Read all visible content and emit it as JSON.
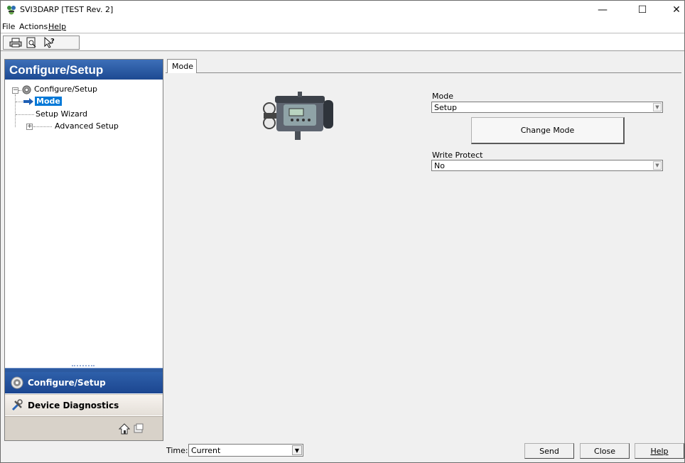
{
  "window": {
    "title": "SVI3DARP [TEST Rev. 2]",
    "controls": {
      "minimize": "—",
      "maximize": "☐",
      "close": "✕"
    }
  },
  "menu": {
    "items": [
      "File",
      "Actions",
      "Help"
    ]
  },
  "toolbar": {
    "icons": [
      "print-icon",
      "print-preview-icon",
      "context-help-icon"
    ]
  },
  "left_panel": {
    "header": "Configure/Setup",
    "tree": {
      "root": "Configure/Setup",
      "children": [
        "Mode",
        "Setup Wizard",
        "Advanced Setup"
      ],
      "selected": "Mode"
    },
    "nav": {
      "configure": "Configure/Setup",
      "diagnostics": "Device Diagnostics"
    }
  },
  "main": {
    "tab": "Mode",
    "mode_label": "Mode",
    "mode_value": "Setup",
    "change_mode_button": "Change Mode",
    "write_protect_label": "Write Protect",
    "write_protect_value": "No"
  },
  "bottom": {
    "time_label": "Time:",
    "time_value": "Current",
    "send": "Send",
    "close": "Close",
    "help": "Help"
  },
  "colors": {
    "header_blue": "#1d4a92",
    "selection_blue": "#0078d7"
  }
}
